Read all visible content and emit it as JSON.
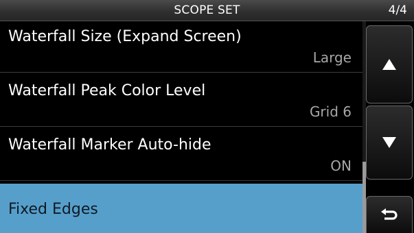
{
  "header": {
    "title": "SCOPE SET",
    "page_indicator": "4/4"
  },
  "menu": {
    "items": [
      {
        "label": "Waterfall Size (Expand Screen)",
        "value": "Large"
      },
      {
        "label": "Waterfall Peak Color Level",
        "value": "Grid 6"
      },
      {
        "label": "Waterfall Marker Auto-hide",
        "value": "ON"
      },
      {
        "label": "Fixed Edges",
        "value": ""
      }
    ],
    "selected_index": 3
  },
  "side_buttons": {
    "up_icon": "triangle-up-icon",
    "down_icon": "triangle-down-icon",
    "back_icon": "return-arrow-icon"
  },
  "colors": {
    "selected_background": "#579fcb",
    "value_text": "#a8a8a8"
  }
}
